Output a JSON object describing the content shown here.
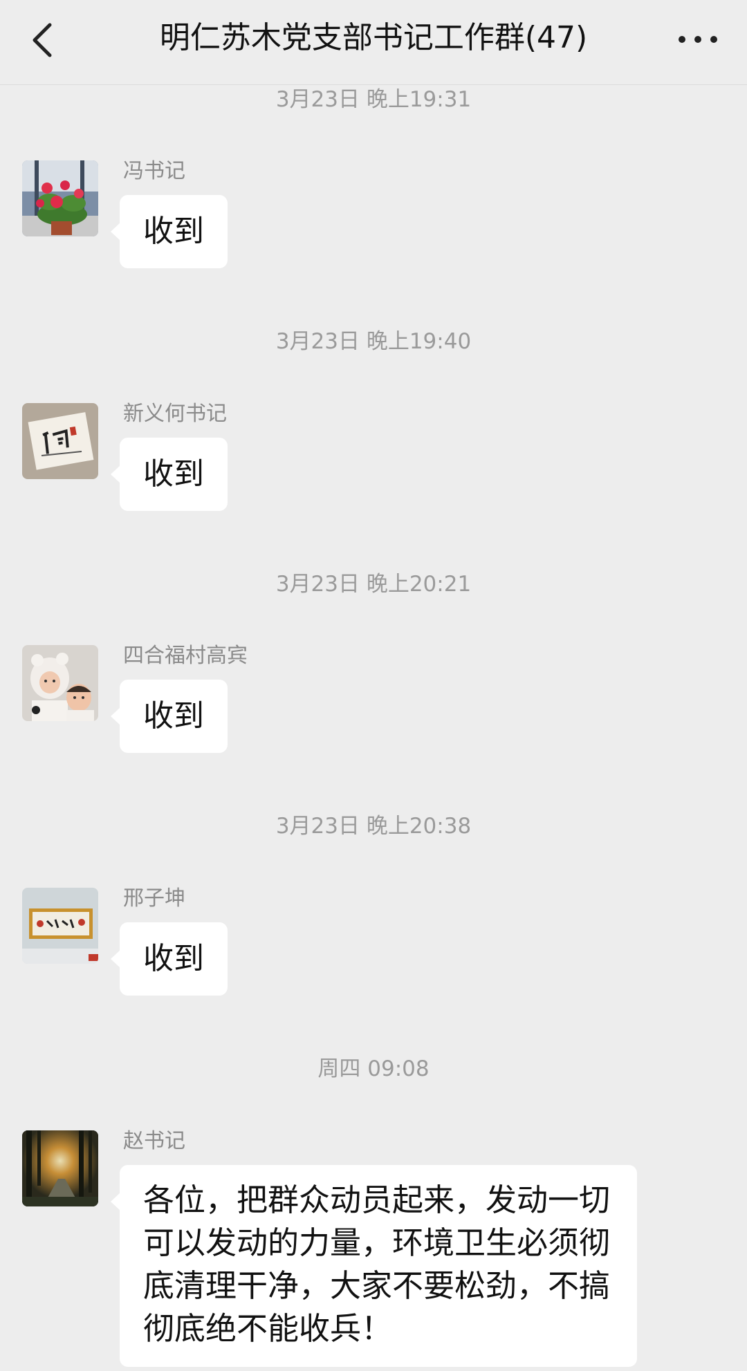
{
  "header": {
    "title": "明仁苏木党支部书记工作群(47)",
    "back_icon": "chevron-left-icon",
    "more_icon": "more-dots-icon"
  },
  "messages": [
    {
      "time": "3月23日 晚上19:31",
      "sender": "冯书记",
      "text": "收到"
    },
    {
      "time": "3月23日 晚上19:40",
      "sender": "新义何书记",
      "text": "收到"
    },
    {
      "time": "3月23日 晚上20:21",
      "sender": "四合福村高宾",
      "text": "收到"
    },
    {
      "time": "3月23日 晚上20:38",
      "sender": "邢子坤",
      "text": "收到"
    },
    {
      "time": "周四 09:08",
      "sender": "赵书记",
      "text": "各位，把群众动员起来，发动一切可以发动的力量，环境卫生必须彻底清理干净，大家不要松劲，不搞彻底绝不能收兵！"
    }
  ]
}
